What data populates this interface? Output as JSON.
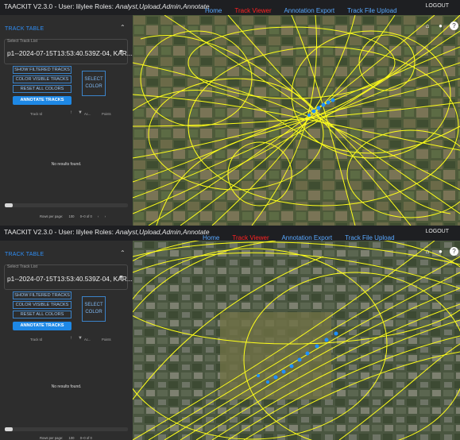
{
  "app": {
    "title": "TAACKIT V2.3.0 - User: lilylee Roles: ",
    "roles": "Analyst,Upload,Admin,Annotate",
    "title_short": "TAACKIT V2.3.0 - User: lilylee Roles: "
  },
  "nav": {
    "items": [
      "Home",
      "Track Viewer",
      "Annotation Export",
      "Track File Upload"
    ],
    "active_index": 1,
    "logout": "LOGOUT"
  },
  "sidebar": {
    "title": "TRACK TABLE",
    "tracklist_label": "Select Track List",
    "tracklist_value": "p1--2024-07-15T13:53:40.539Z-04, KAR...",
    "buttons": {
      "show_filtered": "SHOW FILTERED TRACKS",
      "color_visible": "COLOR VISIBLE TRACKS",
      "reset_colors": "RESET ALL COLORS",
      "select_color_1": "SELECT",
      "select_color_2": "COLOR",
      "annotate": "ANNOTATE TRACKS"
    },
    "table": {
      "col_track_id": "Track Id",
      "col_action": "Ac...",
      "col_points": "Points",
      "empty": "No results found."
    },
    "pager": {
      "rows_label": "Rows per page:",
      "rows_value": "100",
      "range": "0–0 of 0"
    }
  },
  "map": {
    "track_color": "#ffff1a",
    "point_color": "#1e90ff",
    "icons": [
      "home-icon",
      "globe-icon",
      "help-icon"
    ]
  },
  "colors": {
    "accent": "#1e88e5",
    "nav_active": "#ff2222",
    "nav_link": "#5aa9ff"
  }
}
